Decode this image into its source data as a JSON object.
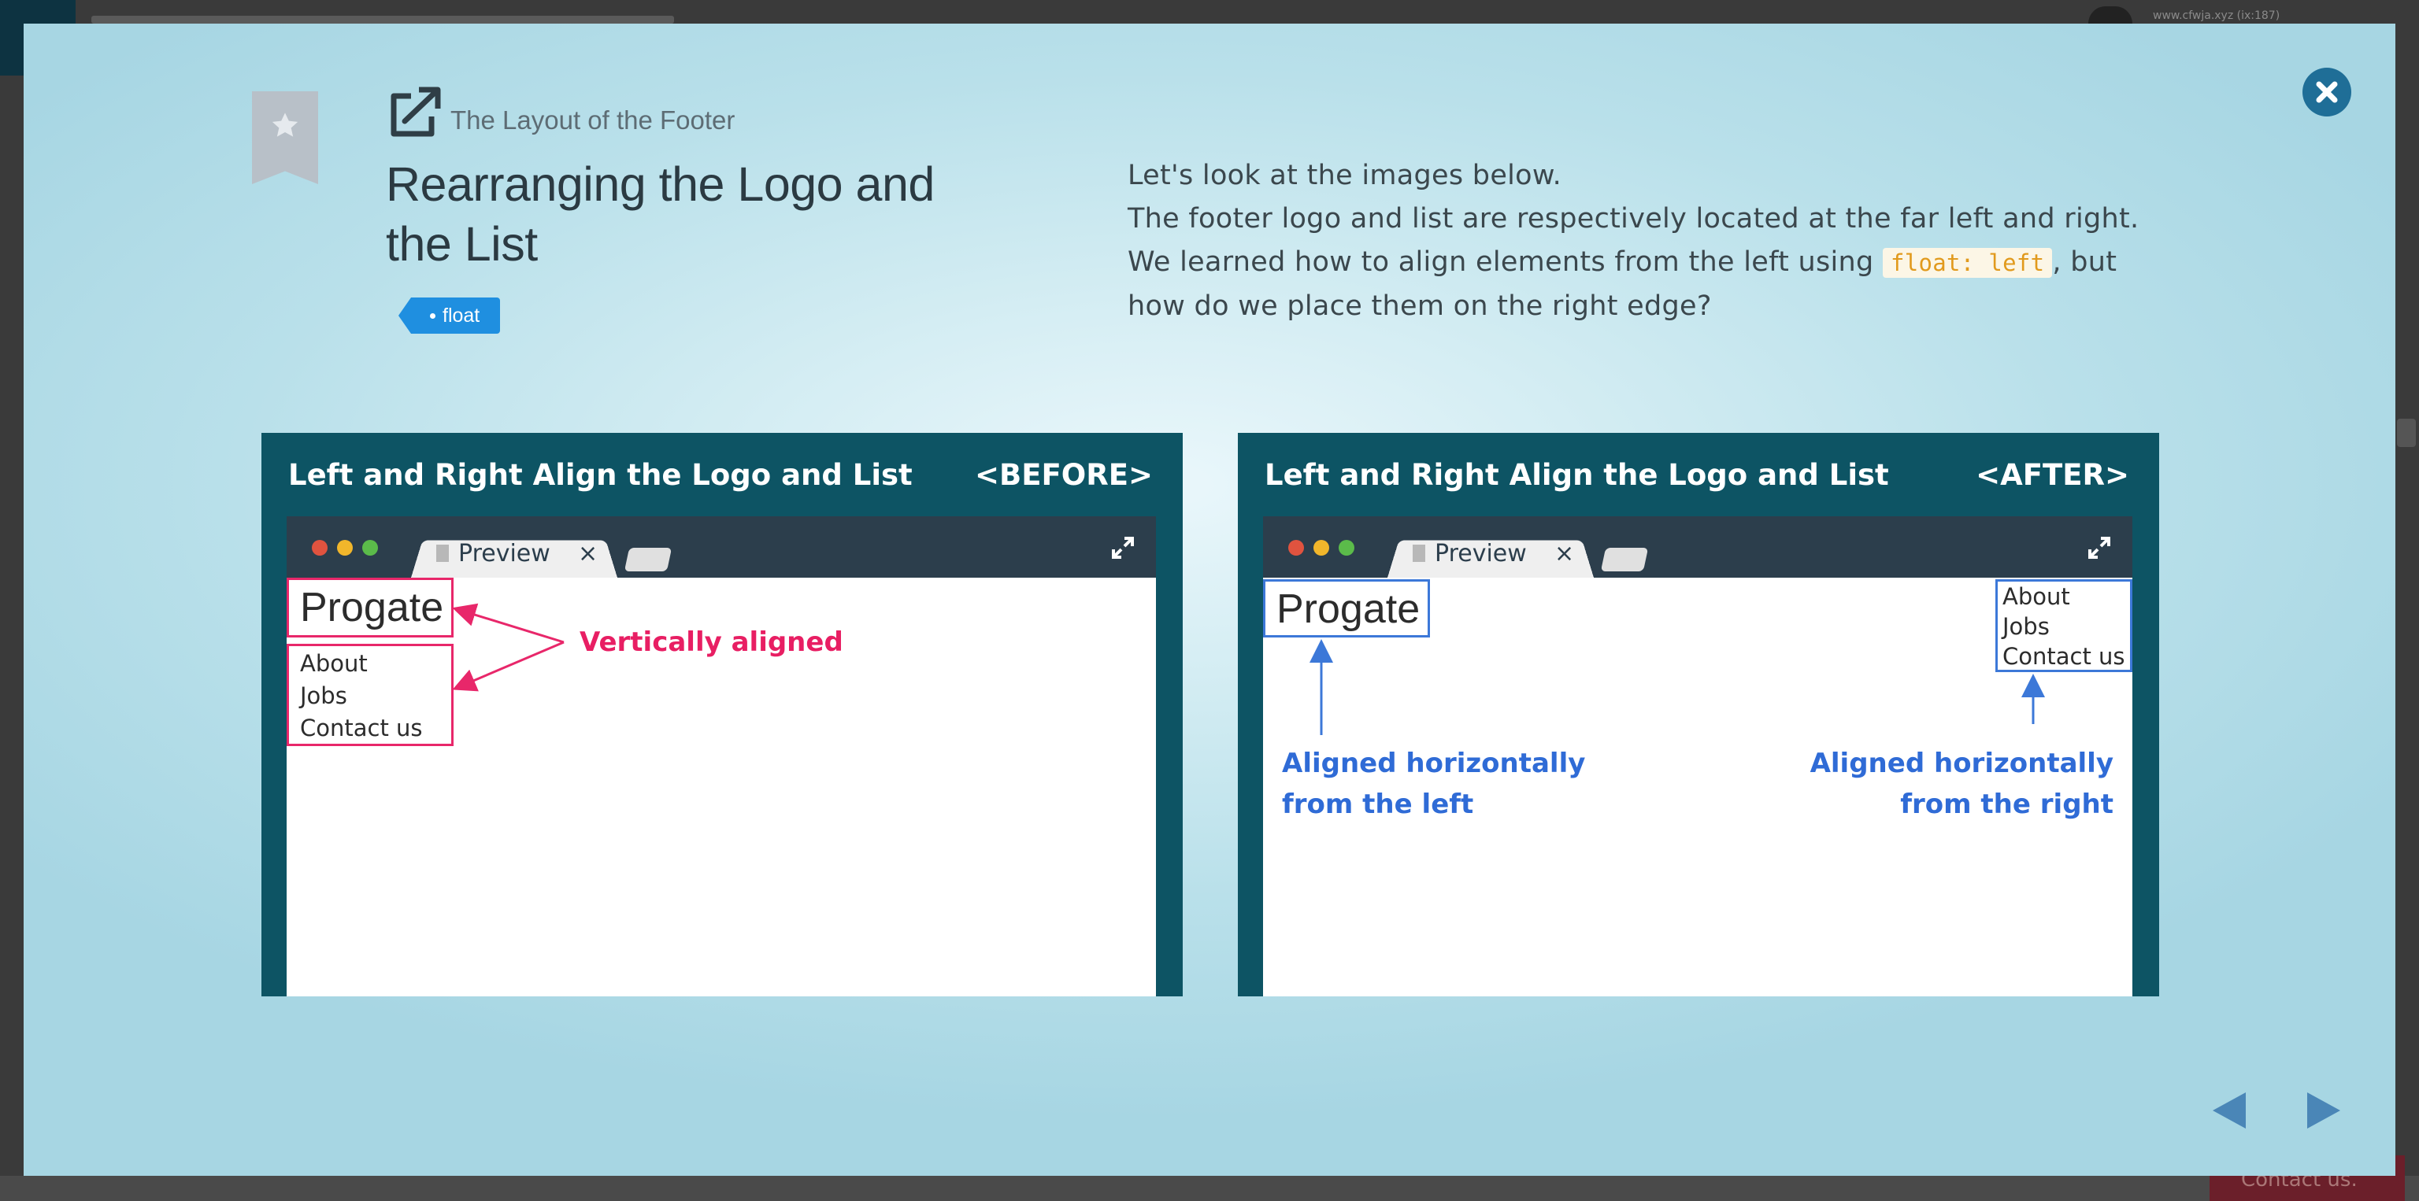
{
  "backdrop": {
    "url_text": "www.cfwja.xyz (ix:187)",
    "contact_text": "Contact us."
  },
  "header": {
    "section": "The Layout of the Footer",
    "title": "Rearranging the Logo and the List",
    "tag": "float"
  },
  "description": {
    "line1": "Let's look at the images below.",
    "line2": "The footer logo and list are respectively located at the far left and right.",
    "line3_pre": "We learned how to align elements from the left using ",
    "line3_code": "float: left",
    "line3_post": ", but",
    "line4": "how do we place them on the right edge?"
  },
  "panels": {
    "before": {
      "heading": "Left and Right Align the Logo and List",
      "badge": "<BEFORE>",
      "tab_label": "Preview",
      "tab_close": "×",
      "logo": "Progate",
      "list": [
        "About",
        "Jobs",
        "Contact us"
      ],
      "annotation": "Vertically aligned",
      "annotation_color": "#e81e63"
    },
    "after": {
      "heading": "Left and Right Align the Logo and List",
      "badge": "<AFTER>",
      "tab_label": "Preview",
      "tab_close": "×",
      "logo": "Progate",
      "list": [
        "About",
        "Jobs",
        "Contact us"
      ],
      "annotation_left_1": "Aligned horizontally",
      "annotation_left_2": "from the left",
      "annotation_right_1": "Aligned horizontally",
      "annotation_right_2": "from the right",
      "annotation_color": "#2f6bd6"
    }
  },
  "icons": {
    "bookmark": "star-bookmark-icon",
    "external": "external-link-icon",
    "close": "close-icon",
    "prev": "prev-arrow-icon",
    "next": "next-arrow-icon",
    "expand": "expand-icon",
    "doc": "document-icon"
  },
  "colors": {
    "panel_bg": "#0d5464",
    "accent_blue": "#1f8fe0",
    "close_bg": "#1f6e97",
    "code_color": "#e19a1d"
  }
}
